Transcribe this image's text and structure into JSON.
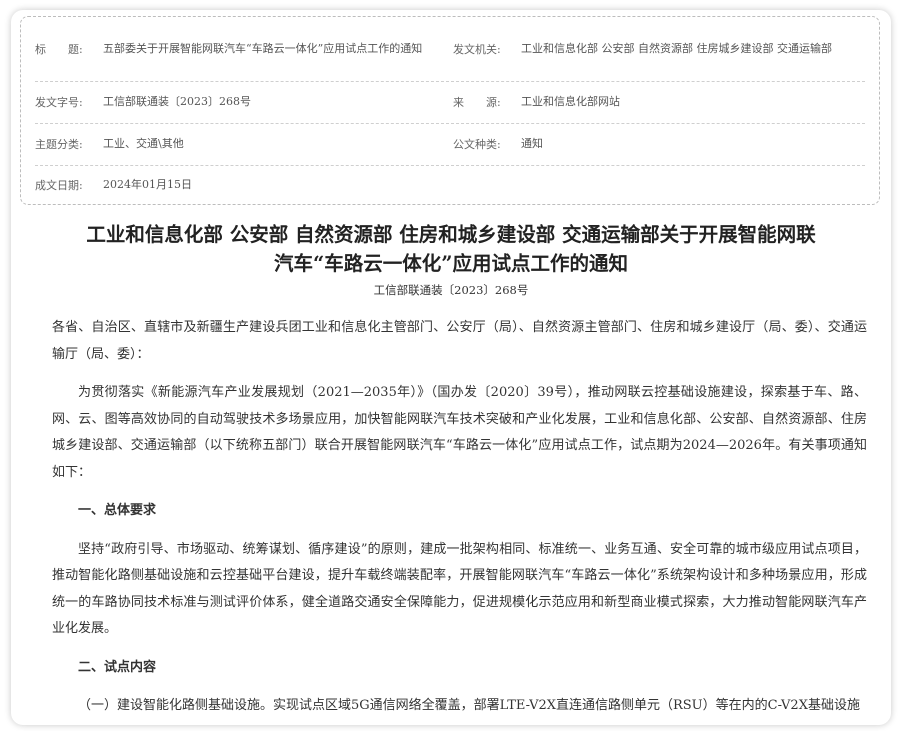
{
  "meta": {
    "rows": [
      {
        "left_label": "标　　题:",
        "left_value": "五部委关于开展智能网联汽车“车路云一体化”应用试点工作的通知",
        "right_label": "发文机关:",
        "right_value": "工业和信息化部 公安部 自然资源部 住房城乡建设部 交通运输部"
      },
      {
        "left_label": "发文字号:",
        "left_value": "工信部联通装〔2023〕268号",
        "right_label": "来　　源:",
        "right_value": "工业和信息化部网站"
      },
      {
        "left_label": "主题分类:",
        "left_value": "工业、交通\\其他",
        "right_label": "公文种类:",
        "right_value": "通知"
      },
      {
        "left_label": "成文日期:",
        "left_value": "2024年01月15日"
      }
    ]
  },
  "document": {
    "title_line1": "工业和信息化部 公安部 自然资源部 住房和城乡建设部 交通运输部关于开展智能网联",
    "title_line2": "汽车“车路云一体化”应用试点工作的通知",
    "doc_number": "工信部联通装〔2023〕268号",
    "addressees": "各省、自治区、直辖市及新疆生产建设兵团工业和信息化主管部门、公安厅（局）、自然资源主管部门、住房和城乡建设厅（局、委）、交通运输厅（局、委）：",
    "intro": "为贯彻落实《新能源汽车产业发展规划（2021—2035年）》（国办发〔2020〕39号），推动网联云控基础设施建设，探索基于车、路、网、云、图等高效协同的自动驾驶技术多场景应用，加快智能网联汽车技术突破和产业化发展，工业和信息化部、公安部、自然资源部、住房城乡建设部、交通运输部（以下统称五部门）联合开展智能网联汽车“车路云一体化”应用试点工作，试点期为2024—2026年。有关事项通知如下：",
    "section1_heading": "一、总体要求",
    "section1_body": "坚持“政府引导、市场驱动、统筹谋划、循序建设”的原则，建成一批架构相同、标准统一、业务互通、安全可靠的城市级应用试点项目，推动智能化路侧基础设施和云控基础平台建设，提升车载终端装配率，开展智能网联汽车“车路云一体化”系统架构设计和多种场景应用，形成统一的车路协同技术标准与测试评价体系，健全道路交通安全保障能力，促进规模化示范应用和新型商业模式探索，大力推动智能网联汽车产业化发展。",
    "section2_heading": "二、试点内容",
    "section2_item1": "（一）建设智能化路侧基础设施。实现试点区域5G通信网络全覆盖，部署LTE-V2X直连通信路侧单元（RSU）等在内的C-V2X基础设施"
  }
}
